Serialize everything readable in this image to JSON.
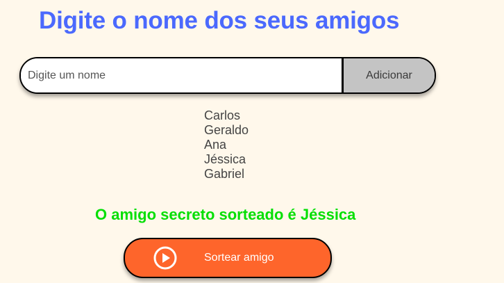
{
  "colors": {
    "title": "#4b69fd",
    "result": "#05df05",
    "add_button_bg": "#c4c4c4",
    "draw_button_bg": "#fe652b",
    "background": "#fff8eb"
  },
  "header": {
    "title": "Digite o nome dos seus amigos"
  },
  "form": {
    "input_value": "",
    "input_placeholder": "Digite um nome",
    "add_label": "Adicionar"
  },
  "friends": [
    "Carlos",
    "Geraldo",
    "Ana",
    "Jéssica",
    "Gabriel"
  ],
  "result": {
    "text": "O amigo secreto sorteado é Jéssica"
  },
  "draw": {
    "label": "Sortear amigo",
    "icon": "play-circle-icon"
  }
}
